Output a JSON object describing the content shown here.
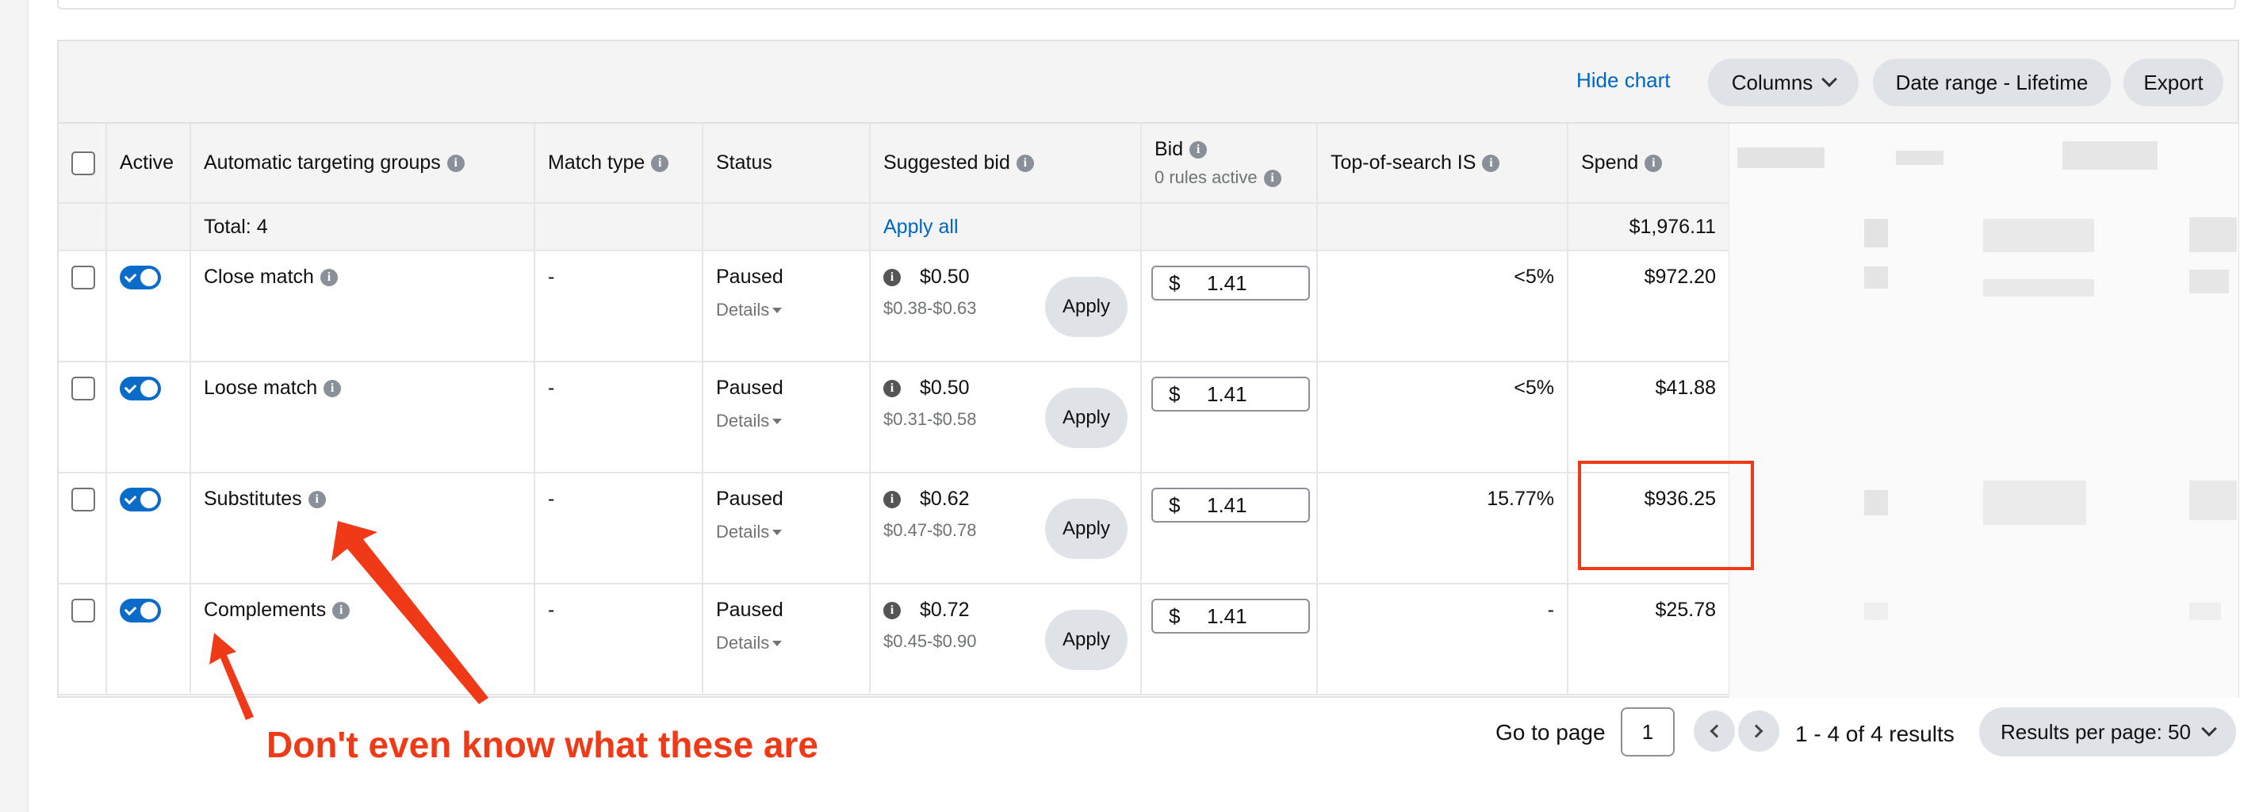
{
  "toolbar": {
    "hide_chart": "Hide chart",
    "columns": "Columns",
    "date_range": "Date range - Lifetime",
    "export": "Export"
  },
  "table": {
    "headers": {
      "active": "Active",
      "targeting_groups": "Automatic targeting groups",
      "match_type": "Match type",
      "status": "Status",
      "suggested_bid": "Suggested bid",
      "bid": "Bid",
      "bid_sub": "0 rules active",
      "top_of_search": "Top-of-search IS",
      "spend": "Spend"
    },
    "total": {
      "label": "Total: 4",
      "apply_all": "Apply all",
      "spend": "$1,976.11"
    },
    "rows": [
      {
        "name": "Close match",
        "match_type": "-",
        "status": "Paused",
        "details": "Details",
        "suggested": "$0.50",
        "range": "$0.38-$0.63",
        "apply": "Apply",
        "currency": "$",
        "bid": "1.41",
        "tos": "<5%",
        "spend": "$972.20"
      },
      {
        "name": "Loose match",
        "match_type": "-",
        "status": "Paused",
        "details": "Details",
        "suggested": "$0.50",
        "range": "$0.31-$0.58",
        "apply": "Apply",
        "currency": "$",
        "bid": "1.41",
        "tos": "<5%",
        "spend": "$41.88"
      },
      {
        "name": "Substitutes",
        "match_type": "-",
        "status": "Paused",
        "details": "Details",
        "suggested": "$0.62",
        "range": "$0.47-$0.78",
        "apply": "Apply",
        "currency": "$",
        "bid": "1.41",
        "tos": "15.77%",
        "spend": "$936.25"
      },
      {
        "name": "Complements",
        "match_type": "-",
        "status": "Paused",
        "details": "Details",
        "suggested": "$0.72",
        "range": "$0.45-$0.90",
        "apply": "Apply",
        "currency": "$",
        "bid": "1.41",
        "tos": "-",
        "spend": "$25.78"
      }
    ]
  },
  "pagination": {
    "go_to_page": "Go to page",
    "page": "1",
    "results": "1 - 4 of 4 results",
    "per_page": "Results per page: 50"
  },
  "annotation": {
    "text": "Don't even know what these are",
    "color": "#f03a17"
  },
  "colors": {
    "link": "#0066c0",
    "toggle_on": "#0b6bc8",
    "pill_bg": "#dfe3e8"
  }
}
